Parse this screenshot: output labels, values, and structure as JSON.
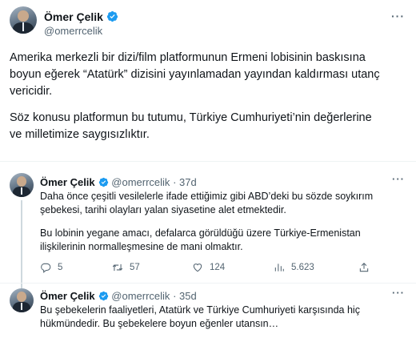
{
  "main_tweet": {
    "author_name": "Ömer Çelik",
    "handle": "@omerrcelik",
    "paragraph_1": "Amerika merkezli bir dizi/film platformunun Ermeni lobisinin baskısına boyun eğerek “Atatürk” dizisini yayınlamadan yayından kaldırması utanç vericidir.",
    "paragraph_2": "Söz konusu platformun bu tutumu, Türkiye Cumhuriyeti’nin değerlerine ve milletimize saygısızlıktır."
  },
  "replies": [
    {
      "author_name": "Ömer Çelik",
      "handle": "@omerrcelik",
      "time": "37d",
      "paragraph_1": "Daha önce çeşitli vesilelerle ifade ettiğimiz gibi ABD’deki bu sözde soykırım şebekesi, tarihi olayları yalan siyasetine alet etmektedir.",
      "paragraph_2": "Bu lobinin yegane amacı, defalarca görüldüğü üzere Türkiye-Ermenistan ilişkilerinin normalleşmesine de mani olmaktır.",
      "replies_count": "5",
      "retweets_count": "57",
      "likes_count": "124",
      "views_count": "5.623"
    },
    {
      "author_name": "Ömer Çelik",
      "handle": "@omerrcelik",
      "time": "35d",
      "paragraph_1": "Bu şebekelerin faaliyetleri, Atatürk ve Türkiye Cumhuriyeti karşısında hiç hükmündedir. Bu şebekelere boyun eğenler utansın…"
    }
  ],
  "icons": {
    "more": "more-horizontal-icon",
    "verified": "verified-badge-icon",
    "reply": "reply-icon",
    "retweet": "retweet-icon",
    "like": "heart-icon",
    "views": "views-icon",
    "share": "share-icon"
  },
  "colors": {
    "verified_blue": "#1d9bf0",
    "secondary_text": "#536471",
    "primary_text": "#0f1419",
    "divider": "#eff3f4"
  }
}
